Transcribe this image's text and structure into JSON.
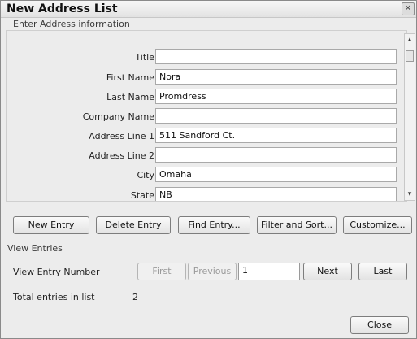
{
  "window": {
    "title": "New Address List",
    "close_glyph": "✕"
  },
  "entry_section": {
    "label": "Enter Address information"
  },
  "fields": [
    {
      "label": "Title",
      "value": ""
    },
    {
      "label": "First Name",
      "value": "Nora"
    },
    {
      "label": "Last Name",
      "value": "Promdress"
    },
    {
      "label": "Company Name",
      "value": ""
    },
    {
      "label": "Address Line 1",
      "value": "511 Sandford Ct."
    },
    {
      "label": "Address Line 2",
      "value": ""
    },
    {
      "label": "City",
      "value": "Omaha"
    },
    {
      "label": "State",
      "value": "NB"
    }
  ],
  "scrollbar": {
    "up_glyph": "▴",
    "down_glyph": "▾"
  },
  "actions": {
    "new_entry": "New Entry",
    "delete_entry": "Delete Entry",
    "find_entry": "Find Entry...",
    "filter_sort": "Filter and Sort...",
    "customize": "Customize..."
  },
  "view_entries": {
    "label": "View Entries",
    "entry_number_label": "View Entry Number",
    "first": "First",
    "previous": "Previous",
    "entry_number_value": "1",
    "next": "Next",
    "last": "Last",
    "total_label": "Total entries in list",
    "total_value": "2"
  },
  "footer": {
    "close": "Close"
  }
}
